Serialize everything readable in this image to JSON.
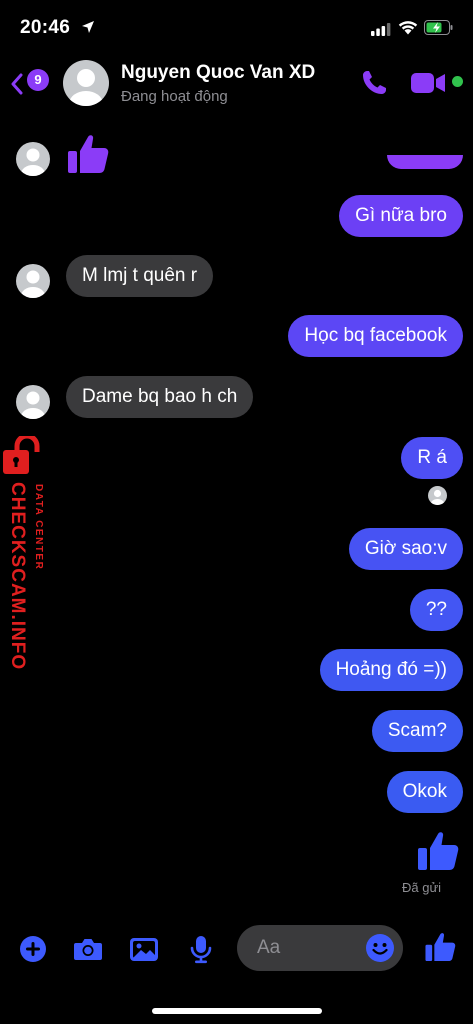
{
  "status_bar": {
    "time": "20:46"
  },
  "header": {
    "back_badge": "9",
    "contact_name": "Nguyen Quoc Van XD",
    "contact_status": "Đang hoạt động"
  },
  "messages": [
    {
      "side": "incoming",
      "kind": "like"
    },
    {
      "side": "outgoing",
      "text": "Gì nữa bro"
    },
    {
      "side": "incoming",
      "text": "M lmj t quên r"
    },
    {
      "side": "outgoing",
      "text": "Học bq facebook"
    },
    {
      "side": "incoming",
      "text": "Dame bq bao h ch"
    },
    {
      "side": "outgoing",
      "text": "R á"
    },
    {
      "side": "outgoing",
      "text": "Giờ sao:v"
    },
    {
      "side": "outgoing",
      "text": "??"
    },
    {
      "side": "outgoing",
      "text": "Hoảng đó =))"
    },
    {
      "side": "outgoing",
      "text": "Scam?"
    },
    {
      "side": "outgoing",
      "text": "Okok"
    },
    {
      "side": "outgoing",
      "kind": "like"
    }
  ],
  "sent_status": "Đã gửi",
  "watermark": {
    "brand": "CHECKSCAM.INFO",
    "sub": "DATA CENTER"
  },
  "composer": {
    "placeholder": "Aa"
  },
  "colors": {
    "accent_purple": "#8b3cf7",
    "accent_blue": "#3d5afe",
    "incoming_bubble": "#3a3a3c",
    "watermark_red": "#e01f1f",
    "online_green": "#31c24d"
  },
  "icons": [
    "location-arrow-icon",
    "signal-icon",
    "wifi-icon",
    "battery-icon",
    "back-chevron-icon",
    "phone-icon",
    "video-camera-icon",
    "thumbs-up-icon",
    "plus-circle-icon",
    "camera-icon",
    "image-icon",
    "microphone-icon",
    "emoji-icon",
    "lock-icon"
  ]
}
